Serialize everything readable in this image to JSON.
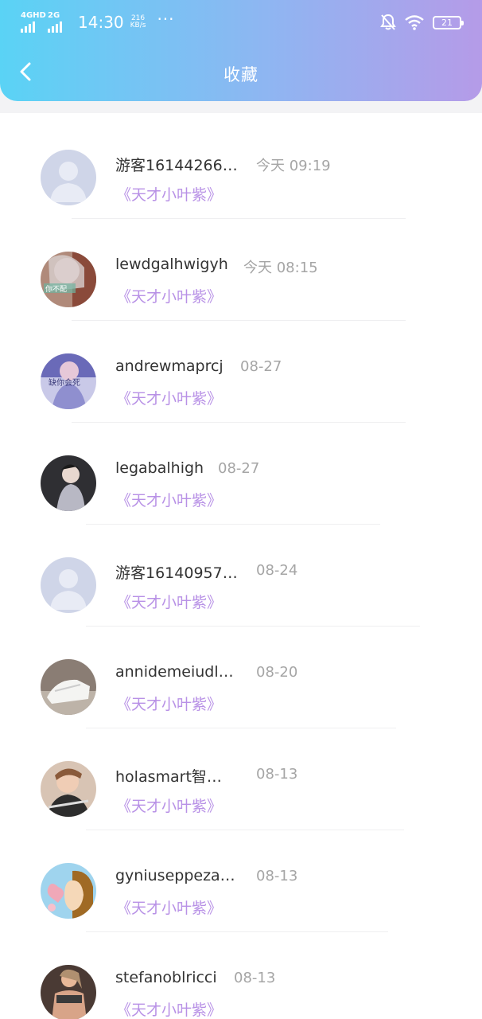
{
  "status_bar": {
    "net1": "4GHD",
    "net2": "2G",
    "clock": "14:30",
    "speed_value": "216",
    "speed_unit": "KB/s",
    "more": "···",
    "battery": "21"
  },
  "header": {
    "title": "收藏",
    "back_icon": "chevron-left-icon"
  },
  "items": [
    {
      "name": "游客16144266…",
      "time": "今天 09:19",
      "book": "《天才小叶紫》",
      "avatar": "default"
    },
    {
      "name": "lewdgalhwigyh",
      "time": "今天 08:15",
      "book": "《天才小叶紫》",
      "avatar": "photo",
      "avatar_text": "你不配"
    },
    {
      "name": "andrewmaprcj",
      "time": "08-27",
      "book": "《天才小叶紫》",
      "avatar": "photo",
      "avatar_text": "缺你会死"
    },
    {
      "name": "legabalhigh",
      "time": "08-27",
      "book": "《天才小叶紫》",
      "avatar": "photo"
    },
    {
      "name": "游客16140957…",
      "time": "08-24",
      "book": "《天才小叶紫》",
      "avatar": "default"
    },
    {
      "name": "annidemeiudl…",
      "time": "08-20",
      "book": "《天才小叶紫》",
      "avatar": "photo"
    },
    {
      "name": "holasmart智…",
      "time": "08-13",
      "book": "《天才小叶紫》",
      "avatar": "photo"
    },
    {
      "name": "gyniuseppeza…",
      "time": "08-13",
      "book": "《天才小叶紫》",
      "avatar": "illustration"
    },
    {
      "name": "stefanoblricci",
      "time": "08-13",
      "book": "《天才小叶紫》",
      "avatar": "photo"
    }
  ]
}
